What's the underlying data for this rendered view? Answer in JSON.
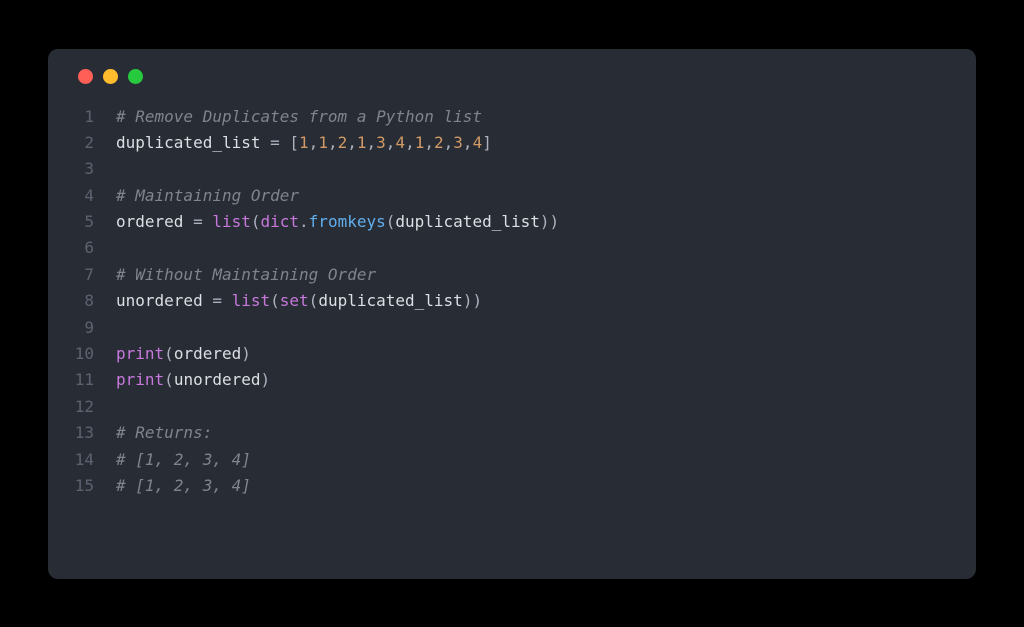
{
  "window": {
    "traffic_lights": [
      "close",
      "minimize",
      "maximize"
    ]
  },
  "code": {
    "lines": [
      {
        "num": "1",
        "tokens": [
          {
            "cls": "tok-comment",
            "t": "# Remove Duplicates from a Python list"
          }
        ]
      },
      {
        "num": "2",
        "tokens": [
          {
            "cls": "tok-white",
            "t": "duplicated_list "
          },
          {
            "cls": "tok-op",
            "t": "= "
          },
          {
            "cls": "tok-punct",
            "t": "["
          },
          {
            "cls": "tok-num",
            "t": "1"
          },
          {
            "cls": "tok-punct",
            "t": ","
          },
          {
            "cls": "tok-num",
            "t": "1"
          },
          {
            "cls": "tok-punct",
            "t": ","
          },
          {
            "cls": "tok-num",
            "t": "2"
          },
          {
            "cls": "tok-punct",
            "t": ","
          },
          {
            "cls": "tok-num",
            "t": "1"
          },
          {
            "cls": "tok-punct",
            "t": ","
          },
          {
            "cls": "tok-num",
            "t": "3"
          },
          {
            "cls": "tok-punct",
            "t": ","
          },
          {
            "cls": "tok-num",
            "t": "4"
          },
          {
            "cls": "tok-punct",
            "t": ","
          },
          {
            "cls": "tok-num",
            "t": "1"
          },
          {
            "cls": "tok-punct",
            "t": ","
          },
          {
            "cls": "tok-num",
            "t": "2"
          },
          {
            "cls": "tok-punct",
            "t": ","
          },
          {
            "cls": "tok-num",
            "t": "3"
          },
          {
            "cls": "tok-punct",
            "t": ","
          },
          {
            "cls": "tok-num",
            "t": "4"
          },
          {
            "cls": "tok-punct",
            "t": "]"
          }
        ]
      },
      {
        "num": "3",
        "tokens": []
      },
      {
        "num": "4",
        "tokens": [
          {
            "cls": "tok-comment",
            "t": "# Maintaining Order"
          }
        ]
      },
      {
        "num": "5",
        "tokens": [
          {
            "cls": "tok-white",
            "t": "ordered "
          },
          {
            "cls": "tok-op",
            "t": "= "
          },
          {
            "cls": "tok-builtin",
            "t": "list"
          },
          {
            "cls": "tok-punct",
            "t": "("
          },
          {
            "cls": "tok-builtin",
            "t": "dict"
          },
          {
            "cls": "tok-punct",
            "t": "."
          },
          {
            "cls": "tok-func",
            "t": "fromkeys"
          },
          {
            "cls": "tok-punct",
            "t": "("
          },
          {
            "cls": "tok-white",
            "t": "duplicated_list"
          },
          {
            "cls": "tok-punct",
            "t": "))"
          }
        ]
      },
      {
        "num": "6",
        "tokens": []
      },
      {
        "num": "7",
        "tokens": [
          {
            "cls": "tok-comment",
            "t": "# Without Maintaining Order"
          }
        ]
      },
      {
        "num": "8",
        "tokens": [
          {
            "cls": "tok-white",
            "t": "unordered "
          },
          {
            "cls": "tok-op",
            "t": "= "
          },
          {
            "cls": "tok-builtin",
            "t": "list"
          },
          {
            "cls": "tok-punct",
            "t": "("
          },
          {
            "cls": "tok-builtin",
            "t": "set"
          },
          {
            "cls": "tok-punct",
            "t": "("
          },
          {
            "cls": "tok-white",
            "t": "duplicated_list"
          },
          {
            "cls": "tok-punct",
            "t": "))"
          }
        ]
      },
      {
        "num": "9",
        "tokens": []
      },
      {
        "num": "10",
        "tokens": [
          {
            "cls": "tok-builtin",
            "t": "print"
          },
          {
            "cls": "tok-punct",
            "t": "("
          },
          {
            "cls": "tok-white",
            "t": "ordered"
          },
          {
            "cls": "tok-punct",
            "t": ")"
          }
        ]
      },
      {
        "num": "11",
        "tokens": [
          {
            "cls": "tok-builtin",
            "t": "print"
          },
          {
            "cls": "tok-punct",
            "t": "("
          },
          {
            "cls": "tok-white",
            "t": "unordered"
          },
          {
            "cls": "tok-punct",
            "t": ")"
          }
        ]
      },
      {
        "num": "12",
        "tokens": []
      },
      {
        "num": "13",
        "tokens": [
          {
            "cls": "tok-comment",
            "t": "# Returns:"
          }
        ]
      },
      {
        "num": "14",
        "tokens": [
          {
            "cls": "tok-comment",
            "t": "# [1, 2, 3, 4]"
          }
        ]
      },
      {
        "num": "15",
        "tokens": [
          {
            "cls": "tok-comment",
            "t": "# [1, 2, 3, 4]"
          }
        ]
      }
    ]
  }
}
